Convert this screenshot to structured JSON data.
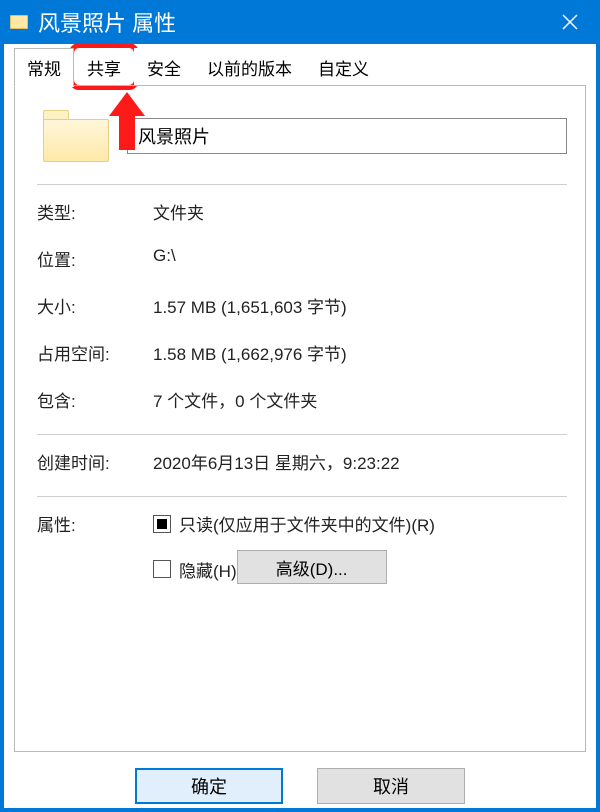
{
  "title": "风景照片 属性",
  "tabs": [
    "常规",
    "共享",
    "安全",
    "以前的版本",
    "自定义"
  ],
  "active_tab_index": 0,
  "highlight_tab_index": 1,
  "folder_name": "风景照片",
  "fields": {
    "type_label": "类型:",
    "type_value": "文件夹",
    "location_label": "位置:",
    "location_value": "G:\\",
    "size_label": "大小:",
    "size_value": "1.57 MB (1,651,603 字节)",
    "sizeondisk_label": "占用空间:",
    "sizeondisk_value": "1.58 MB (1,662,976 字节)",
    "contains_label": "包含:",
    "contains_value": "7 个文件，0 个文件夹",
    "created_label": "创建时间:",
    "created_value": "2020年6月13日 星期六，9:23:22",
    "attr_label": "属性:",
    "readonly_label": "只读(仅应用于文件夹中的文件)(R)",
    "hidden_label": "隐藏(H)",
    "advanced_label": "高级(D)..."
  },
  "checkboxes": {
    "readonly_state": "indeterminate",
    "hidden_state": "unchecked"
  },
  "buttons": {
    "ok": "确定",
    "cancel": "取消"
  }
}
